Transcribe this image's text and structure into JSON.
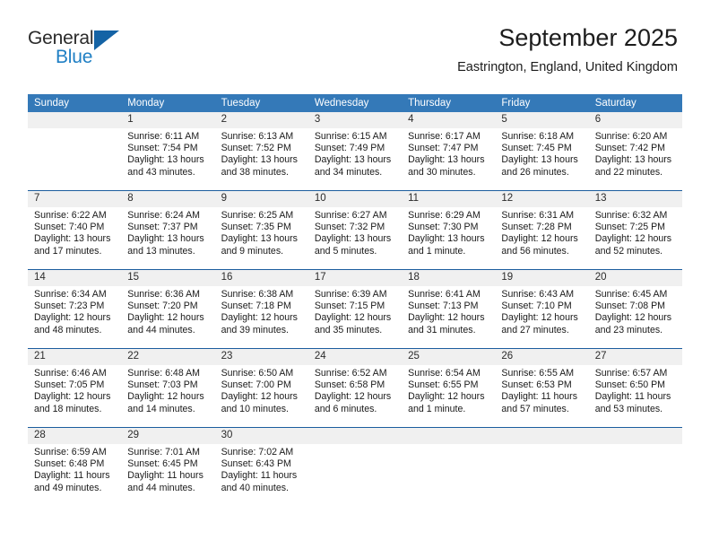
{
  "brand": {
    "name_part1": "General",
    "name_part2": "Blue",
    "triangle_color": "#1463a5",
    "blue_color": "#1f7fc4"
  },
  "header": {
    "title": "September 2025",
    "subtitle": "Eastrington, England, United Kingdom"
  },
  "theme": {
    "header_row_bg": "#3479b8",
    "daynum_band_bg": "#f0f0f0",
    "week_divider": "#1c5d9e"
  },
  "weekdays": [
    "Sunday",
    "Monday",
    "Tuesday",
    "Wednesday",
    "Thursday",
    "Friday",
    "Saturday"
  ],
  "weeks": [
    {
      "days": [
        {
          "num": "",
          "lines": [
            "",
            "",
            "",
            ""
          ],
          "empty": true
        },
        {
          "num": "1",
          "lines": [
            "Sunrise: 6:11 AM",
            "Sunset: 7:54 PM",
            "Daylight: 13 hours",
            "and 43 minutes."
          ]
        },
        {
          "num": "2",
          "lines": [
            "Sunrise: 6:13 AM",
            "Sunset: 7:52 PM",
            "Daylight: 13 hours",
            "and 38 minutes."
          ]
        },
        {
          "num": "3",
          "lines": [
            "Sunrise: 6:15 AM",
            "Sunset: 7:49 PM",
            "Daylight: 13 hours",
            "and 34 minutes."
          ]
        },
        {
          "num": "4",
          "lines": [
            "Sunrise: 6:17 AM",
            "Sunset: 7:47 PM",
            "Daylight: 13 hours",
            "and 30 minutes."
          ]
        },
        {
          "num": "5",
          "lines": [
            "Sunrise: 6:18 AM",
            "Sunset: 7:45 PM",
            "Daylight: 13 hours",
            "and 26 minutes."
          ]
        },
        {
          "num": "6",
          "lines": [
            "Sunrise: 6:20 AM",
            "Sunset: 7:42 PM",
            "Daylight: 13 hours",
            "and 22 minutes."
          ]
        }
      ]
    },
    {
      "days": [
        {
          "num": "7",
          "lines": [
            "Sunrise: 6:22 AM",
            "Sunset: 7:40 PM",
            "Daylight: 13 hours",
            "and 17 minutes."
          ]
        },
        {
          "num": "8",
          "lines": [
            "Sunrise: 6:24 AM",
            "Sunset: 7:37 PM",
            "Daylight: 13 hours",
            "and 13 minutes."
          ]
        },
        {
          "num": "9",
          "lines": [
            "Sunrise: 6:25 AM",
            "Sunset: 7:35 PM",
            "Daylight: 13 hours",
            "and 9 minutes."
          ]
        },
        {
          "num": "10",
          "lines": [
            "Sunrise: 6:27 AM",
            "Sunset: 7:32 PM",
            "Daylight: 13 hours",
            "and 5 minutes."
          ]
        },
        {
          "num": "11",
          "lines": [
            "Sunrise: 6:29 AM",
            "Sunset: 7:30 PM",
            "Daylight: 13 hours",
            "and 1 minute."
          ]
        },
        {
          "num": "12",
          "lines": [
            "Sunrise: 6:31 AM",
            "Sunset: 7:28 PM",
            "Daylight: 12 hours",
            "and 56 minutes."
          ]
        },
        {
          "num": "13",
          "lines": [
            "Sunrise: 6:32 AM",
            "Sunset: 7:25 PM",
            "Daylight: 12 hours",
            "and 52 minutes."
          ]
        }
      ]
    },
    {
      "days": [
        {
          "num": "14",
          "lines": [
            "Sunrise: 6:34 AM",
            "Sunset: 7:23 PM",
            "Daylight: 12 hours",
            "and 48 minutes."
          ]
        },
        {
          "num": "15",
          "lines": [
            "Sunrise: 6:36 AM",
            "Sunset: 7:20 PM",
            "Daylight: 12 hours",
            "and 44 minutes."
          ]
        },
        {
          "num": "16",
          "lines": [
            "Sunrise: 6:38 AM",
            "Sunset: 7:18 PM",
            "Daylight: 12 hours",
            "and 39 minutes."
          ]
        },
        {
          "num": "17",
          "lines": [
            "Sunrise: 6:39 AM",
            "Sunset: 7:15 PM",
            "Daylight: 12 hours",
            "and 35 minutes."
          ]
        },
        {
          "num": "18",
          "lines": [
            "Sunrise: 6:41 AM",
            "Sunset: 7:13 PM",
            "Daylight: 12 hours",
            "and 31 minutes."
          ]
        },
        {
          "num": "19",
          "lines": [
            "Sunrise: 6:43 AM",
            "Sunset: 7:10 PM",
            "Daylight: 12 hours",
            "and 27 minutes."
          ]
        },
        {
          "num": "20",
          "lines": [
            "Sunrise: 6:45 AM",
            "Sunset: 7:08 PM",
            "Daylight: 12 hours",
            "and 23 minutes."
          ]
        }
      ]
    },
    {
      "days": [
        {
          "num": "21",
          "lines": [
            "Sunrise: 6:46 AM",
            "Sunset: 7:05 PM",
            "Daylight: 12 hours",
            "and 18 minutes."
          ]
        },
        {
          "num": "22",
          "lines": [
            "Sunrise: 6:48 AM",
            "Sunset: 7:03 PM",
            "Daylight: 12 hours",
            "and 14 minutes."
          ]
        },
        {
          "num": "23",
          "lines": [
            "Sunrise: 6:50 AM",
            "Sunset: 7:00 PM",
            "Daylight: 12 hours",
            "and 10 minutes."
          ]
        },
        {
          "num": "24",
          "lines": [
            "Sunrise: 6:52 AM",
            "Sunset: 6:58 PM",
            "Daylight: 12 hours",
            "and 6 minutes."
          ]
        },
        {
          "num": "25",
          "lines": [
            "Sunrise: 6:54 AM",
            "Sunset: 6:55 PM",
            "Daylight: 12 hours",
            "and 1 minute."
          ]
        },
        {
          "num": "26",
          "lines": [
            "Sunrise: 6:55 AM",
            "Sunset: 6:53 PM",
            "Daylight: 11 hours",
            "and 57 minutes."
          ]
        },
        {
          "num": "27",
          "lines": [
            "Sunrise: 6:57 AM",
            "Sunset: 6:50 PM",
            "Daylight: 11 hours",
            "and 53 minutes."
          ]
        }
      ]
    },
    {
      "days": [
        {
          "num": "28",
          "lines": [
            "Sunrise: 6:59 AM",
            "Sunset: 6:48 PM",
            "Daylight: 11 hours",
            "and 49 minutes."
          ]
        },
        {
          "num": "29",
          "lines": [
            "Sunrise: 7:01 AM",
            "Sunset: 6:45 PM",
            "Daylight: 11 hours",
            "and 44 minutes."
          ]
        },
        {
          "num": "30",
          "lines": [
            "Sunrise: 7:02 AM",
            "Sunset: 6:43 PM",
            "Daylight: 11 hours",
            "and 40 minutes."
          ]
        },
        {
          "num": "",
          "lines": [
            "",
            "",
            "",
            ""
          ],
          "empty": true
        },
        {
          "num": "",
          "lines": [
            "",
            "",
            "",
            ""
          ],
          "empty": true
        },
        {
          "num": "",
          "lines": [
            "",
            "",
            "",
            ""
          ],
          "empty": true
        },
        {
          "num": "",
          "lines": [
            "",
            "",
            "",
            ""
          ],
          "empty": true
        }
      ]
    }
  ]
}
